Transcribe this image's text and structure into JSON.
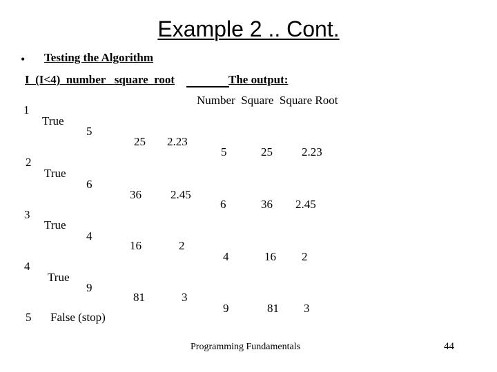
{
  "slide": {
    "title": "Example 2 .. Cont.",
    "bullet": "•",
    "subheading": "Testing the Algorithm",
    "trace_header": "I  (I<4)  number   square  root",
    "output_header": "The output:",
    "output_columns": "Number  Square  Square Root",
    "trace_rows": [
      {
        "i": "1",
        "cond": "True",
        "number": "5",
        "square": "25",
        "root": "2.23"
      },
      {
        "i": "2",
        "cond": "True",
        "number": "6",
        "square": "36",
        "root": "2.45"
      },
      {
        "i": "3",
        "cond": "True",
        "number": "4",
        "square": "16",
        "root": "2"
      },
      {
        "i": "4",
        "cond": "True",
        "number": "9",
        "square": "81",
        "root": "3"
      },
      {
        "i": "5",
        "cond": "False (stop)"
      }
    ],
    "output_rows": [
      {
        "number": "5",
        "square": "25",
        "root": "2.23"
      },
      {
        "number": "6",
        "square": "36",
        "root": "2.45"
      },
      {
        "number": "4",
        "square": "16",
        "root": "2"
      },
      {
        "number": "9",
        "square": "81",
        "root": "3"
      }
    ],
    "footer": "Programming Fundamentals",
    "page_number": "44"
  }
}
